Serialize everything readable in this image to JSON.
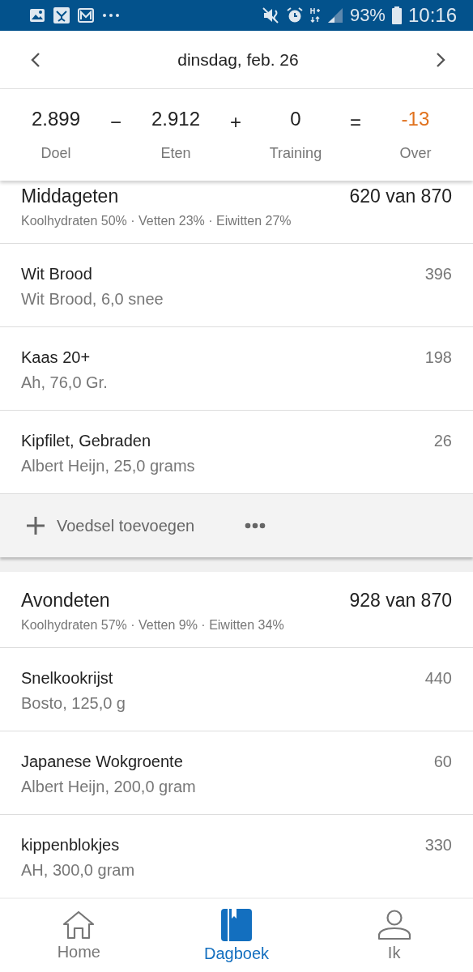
{
  "status_bar": {
    "battery": "93%",
    "time": "10:16"
  },
  "date_header": {
    "date": "dinsdag, feb. 26"
  },
  "summary": {
    "terms": [
      {
        "value": "2.899",
        "label": "Doel",
        "kind": "term"
      },
      {
        "op": "−"
      },
      {
        "value": "2.912",
        "label": "Eten",
        "kind": "term"
      },
      {
        "op": "+"
      },
      {
        "value": "0",
        "label": "Training",
        "kind": "term"
      },
      {
        "op": "="
      },
      {
        "value": "-13",
        "label": "Over",
        "kind": "result"
      }
    ]
  },
  "meals": [
    {
      "name": "Middageten",
      "total": "620 van 870",
      "macros": "Koolhydraten 50% · Vetten 23% · Eiwitten 27%",
      "items": [
        {
          "name": "Wit Brood",
          "detail": "Wit Brood, 6,0 snee",
          "calories": "396"
        },
        {
          "name": "Kaas 20+",
          "detail": "Ah, 76,0 Gr.",
          "calories": "198"
        },
        {
          "name": "Kipfilet, Gebraden",
          "detail": "Albert Heijn, 25,0 grams",
          "calories": "26"
        }
      ],
      "add_label": "Voedsel toevoegen"
    },
    {
      "name": "Avondeten",
      "total": "928 van 870",
      "macros": "Koolhydraten 57% · Vetten 9% · Eiwitten 34%",
      "items": [
        {
          "name": "Snelkookrijst",
          "detail": "Bosto, 125,0 g",
          "calories": "440"
        },
        {
          "name": "Japanese Wokgroente",
          "detail": "Albert Heijn, 200,0 gram",
          "calories": "60"
        },
        {
          "name": "kippenblokjes",
          "detail": "AH, 300,0 gram",
          "calories": "330"
        }
      ]
    }
  ],
  "bottom_nav": [
    {
      "label": "Home",
      "kind": "home",
      "selected": false
    },
    {
      "label": "Dagboek",
      "kind": "diary",
      "selected": true
    },
    {
      "label": "Ik",
      "kind": "profile",
      "selected": false
    }
  ]
}
